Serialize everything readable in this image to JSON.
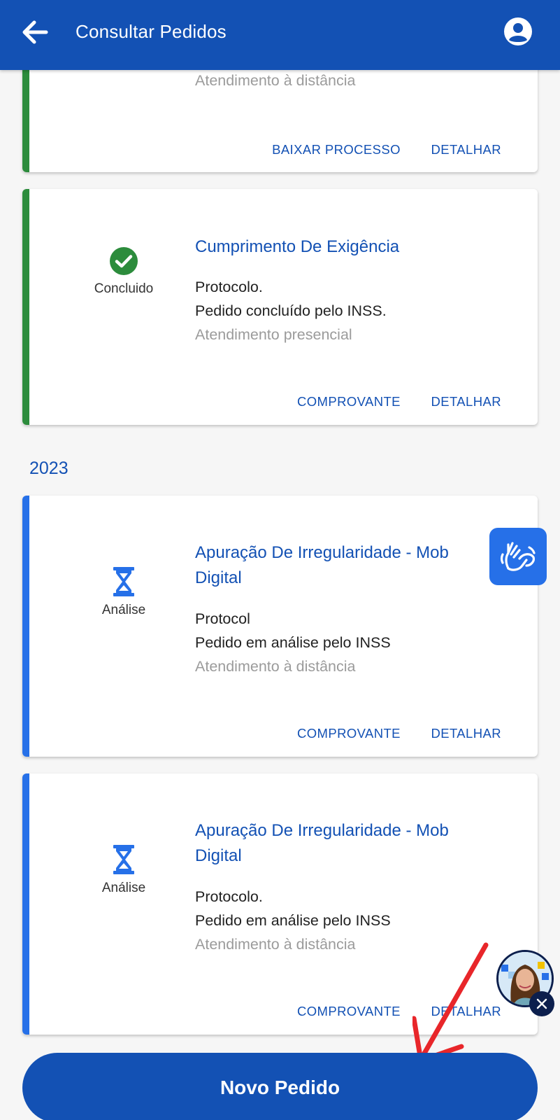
{
  "header": {
    "title": "Consultar Pedidos"
  },
  "cards_top": [
    {
      "mode": "Atendimento à distância",
      "actions": [
        "BAIXAR PROCESSO",
        "DETALHAR"
      ]
    },
    {
      "status": "Concluido",
      "title": "Cumprimento De Exigência",
      "protocol": "Protocolo.",
      "description": "Pedido concluído pelo INSS.",
      "mode": "Atendimento presencial",
      "actions": [
        "COMPROVANTE",
        "DETALHAR"
      ]
    }
  ],
  "year_label": "2023",
  "cards_2023": [
    {
      "status": "Análise",
      "title_line1": "Apuração De Irregularidade - Mob",
      "title_line2": "Digital",
      "protocol": "Protocol",
      "description": "Pedido em análise pelo INSS",
      "mode": "Atendimento à distância",
      "actions": [
        "COMPROVANTE",
        "DETALHAR"
      ]
    },
    {
      "status": "Análise",
      "title_line1": "Apuração De Irregularidade - Mob",
      "title_line2": "Digital",
      "protocol": "Protocolo.",
      "description": "Pedido em análise pelo INSS",
      "mode": "Atendimento à distância",
      "actions": [
        "COMPROVANTE",
        "DETALHAR"
      ]
    }
  ],
  "new_request_button": "Novo Pedido",
  "icons": {
    "back": "arrow-left-icon",
    "account": "account-circle-icon",
    "done": "check-circle-icon",
    "pending": "hourglass-icon",
    "libras": "sign-language-icon",
    "assistant": "assistant-avatar",
    "close": "close-icon"
  },
  "colors": {
    "primary": "#1351b4",
    "success": "#2c8c3c",
    "pending": "#2670e8",
    "annotation": "#e8262a"
  }
}
